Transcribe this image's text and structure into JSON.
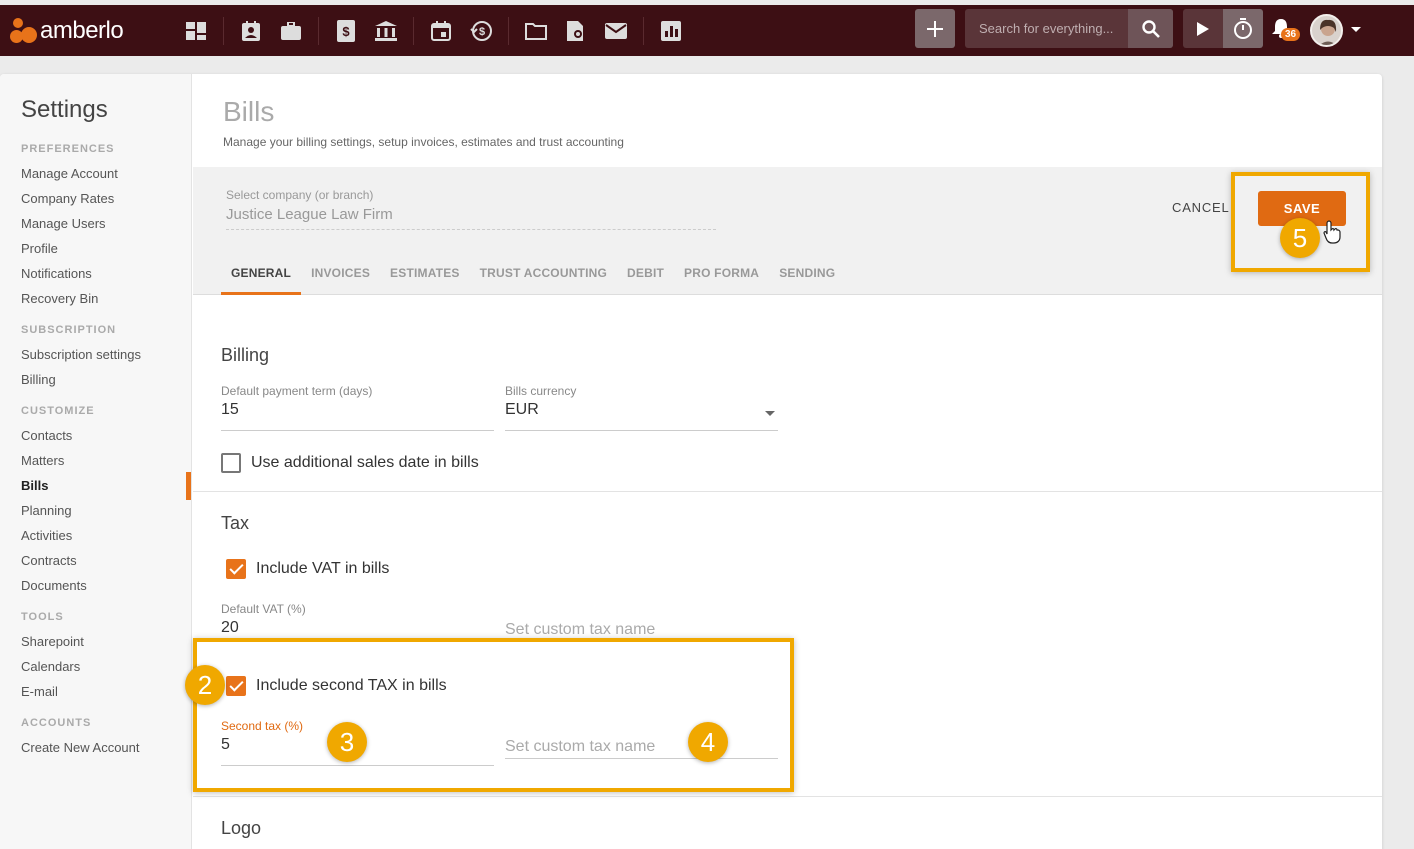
{
  "topbar": {
    "logo_text": "amberlo",
    "nav_icons": [
      "dashboard-icon",
      "contacts-icon",
      "matters-icon",
      "bills-icon",
      "bank-icon",
      "calendar-icon",
      "activities-icon",
      "folder-icon",
      "contracts-icon",
      "mail-icon",
      "reports-icon"
    ],
    "search_placeholder": "Search for everything...",
    "notification_count": "36"
  },
  "sidebar": {
    "title": "Settings",
    "sections": [
      {
        "label": "PREFERENCES",
        "items": [
          "Manage Account",
          "Company Rates",
          "Manage Users",
          "Profile",
          "Notifications",
          "Recovery Bin"
        ]
      },
      {
        "label": "SUBSCRIPTION",
        "items": [
          "Subscription settings",
          "Billing"
        ]
      },
      {
        "label": "CUSTOMIZE",
        "items": [
          "Contacts",
          "Matters",
          "Bills",
          "Planning",
          "Activities",
          "Contracts",
          "Documents"
        ]
      },
      {
        "label": "TOOLS",
        "items": [
          "Sharepoint",
          "Calendars",
          "E-mail"
        ]
      },
      {
        "label": "ACCOUNTS",
        "items": [
          "Create New Account"
        ]
      }
    ],
    "active_item": "Bills"
  },
  "page": {
    "title": "Bills",
    "subtitle": "Manage your billing settings, setup invoices, estimates and trust accounting",
    "company_label": "Select company (or branch)",
    "company_value": "Justice League Law Firm",
    "cancel_label": "CANCEL",
    "save_label": "SAVE",
    "tabs": [
      "GENERAL",
      "INVOICES",
      "ESTIMATES",
      "TRUST ACCOUNTING",
      "DEBIT",
      "PRO FORMA",
      "SENDING"
    ],
    "active_tab": "GENERAL"
  },
  "billing": {
    "title": "Billing",
    "payment_term_label": "Default payment term (days)",
    "payment_term_value": "15",
    "currency_label": "Bills currency",
    "currency_value": "EUR",
    "sales_date_label": "Use additional sales date in bills",
    "sales_date_checked": false
  },
  "tax": {
    "title": "Tax",
    "include_vat_label": "Include VAT in bills",
    "include_vat_checked": true,
    "vat_label": "Default VAT (%)",
    "vat_value": "20",
    "vat_custom_name_placeholder": "Set custom tax name",
    "second_tax_checkbox_label": "Include second TAX in bills",
    "second_tax_checked": true,
    "second_tax_label": "Second tax (%)",
    "second_tax_value": "5",
    "second_tax_custom_name_placeholder": "Set custom tax name"
  },
  "logo_section": {
    "title": "Logo"
  },
  "tutorial_steps": [
    "2",
    "3",
    "4",
    "5"
  ],
  "colors": {
    "accent": "#e8731a",
    "topbar": "#3d0f14",
    "highlight": "#f0a800"
  }
}
